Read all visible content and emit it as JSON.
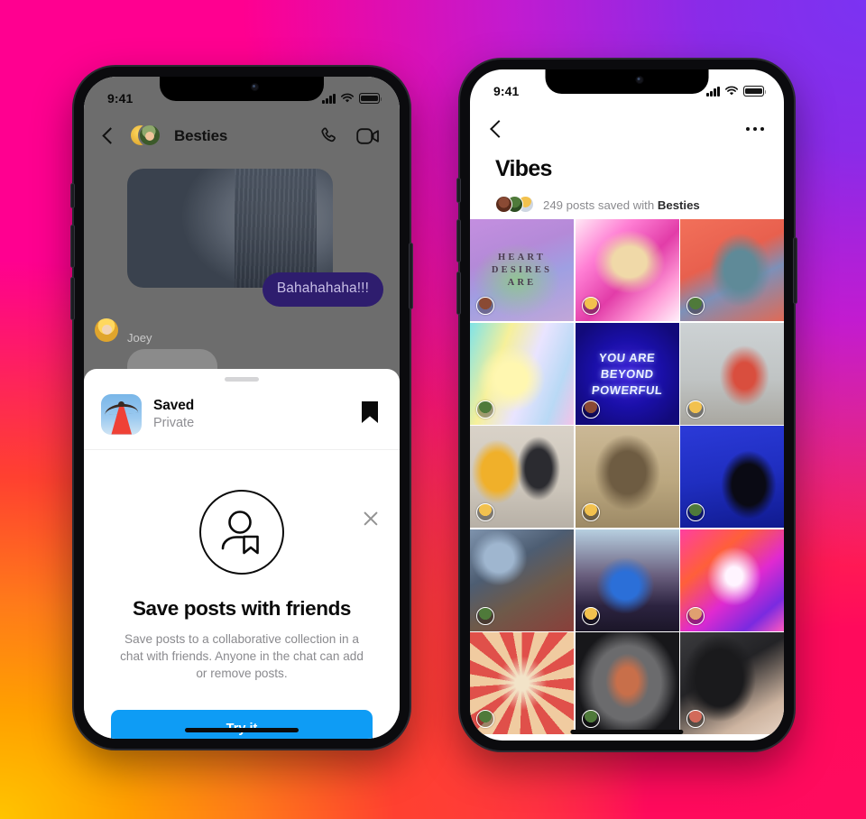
{
  "background": {
    "colors": [
      "#FF0090",
      "#7733F0",
      "#FF0D5C",
      "#FFB800"
    ]
  },
  "left_phone": {
    "status_bar": {
      "time": "9:41",
      "cellular": "signal-bars",
      "wifi": "wifi-icon",
      "battery": "battery-icon"
    },
    "chat": {
      "back": "back-icon",
      "title": "Besties",
      "call_icon": "phone-call-icon",
      "video_icon": "video-camera-icon",
      "outgoing_message": "Bahahahaha!!!",
      "sender_name": "Joey"
    },
    "sheet": {
      "thumb_alt": "saved-collection-thumbnail",
      "title": "Saved",
      "subtitle": "Private",
      "bookmark_icon": "bookmark-icon",
      "close_icon": "close-icon",
      "hero_icon": "person-with-bookmark-icon",
      "hero_title": "Save posts with friends",
      "hero_desc": "Save posts to a collaborative collection in a chat with friends. Anyone in the chat can add or remove posts.",
      "cta_label": "Try it",
      "cta_color": "#0e9cf5"
    }
  },
  "right_phone": {
    "status_bar": {
      "time": "9:41",
      "cellular": "signal-bars",
      "wifi": "wifi-icon",
      "battery": "battery-icon"
    },
    "nav": {
      "back": "back-icon",
      "more": "more-options-icon"
    },
    "collection": {
      "title": "Vibes",
      "meta_count": "249 posts saved with",
      "meta_group": "Besties",
      "avatars": 3
    },
    "grid": [
      {
        "id": "post-1",
        "art": "art1",
        "caption_lines": [
          "HEART",
          "DESIRES",
          "ARE"
        ],
        "badge": "#8a4a34"
      },
      {
        "id": "post-2",
        "art": "art2",
        "caption_lines": [],
        "badge": "#f2c14e"
      },
      {
        "id": "post-3",
        "art": "art3",
        "caption_lines": [],
        "badge": "#4f7a3a"
      },
      {
        "id": "post-4",
        "art": "art4",
        "caption_lines": [],
        "badge": "#4f7a3a"
      },
      {
        "id": "post-5",
        "art": "art5",
        "caption_lines": [
          "YOU ARE",
          "BEYOND",
          "POWERFUL"
        ],
        "badge": "#8a4a34"
      },
      {
        "id": "post-6",
        "art": "art6",
        "caption_lines": [],
        "badge": "#f2c14e"
      },
      {
        "id": "post-7",
        "art": "art7",
        "caption_lines": [],
        "badge": "#f2c14e"
      },
      {
        "id": "post-8",
        "art": "art8",
        "caption_lines": [],
        "badge": "#f2c14e"
      },
      {
        "id": "post-9",
        "art": "art9",
        "caption_lines": [],
        "badge": "#4f7a3a"
      },
      {
        "id": "post-10",
        "art": "art10",
        "caption_lines": [],
        "badge": "#4f7a3a"
      },
      {
        "id": "post-11",
        "art": "art11",
        "caption_lines": [],
        "badge": "#f2c14e"
      },
      {
        "id": "post-12",
        "art": "art12",
        "caption_lines": [],
        "badge": "#e0a070"
      },
      {
        "id": "post-13",
        "art": "art13",
        "caption_lines": [],
        "badge": "#4f7a3a"
      },
      {
        "id": "post-14",
        "art": "art14",
        "caption_lines": [],
        "badge": "#4f7a3a"
      },
      {
        "id": "post-15",
        "art": "art15",
        "caption_lines": [],
        "badge": "#d26a5a"
      }
    ]
  }
}
